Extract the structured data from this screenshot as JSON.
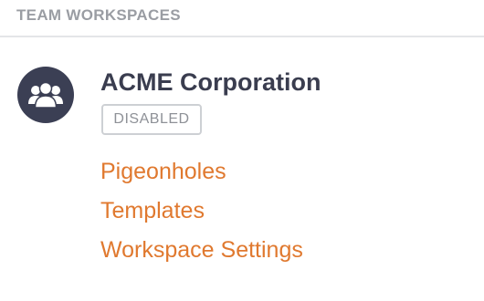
{
  "section": {
    "title": "TEAM WORKSPACES"
  },
  "workspace": {
    "avatar_icon": "team-users-icon",
    "name": "ACME Corporation",
    "status_badge": "DISABLED",
    "links": [
      {
        "label": "Pigeonholes"
      },
      {
        "label": "Templates"
      },
      {
        "label": "Workspace Settings"
      }
    ]
  },
  "colors": {
    "link": "#e0792f",
    "avatar_bg": "#3b3f54",
    "title_text": "#3a3d4f",
    "header_text": "#9a9da3",
    "badge_border": "#cdd0d4"
  }
}
